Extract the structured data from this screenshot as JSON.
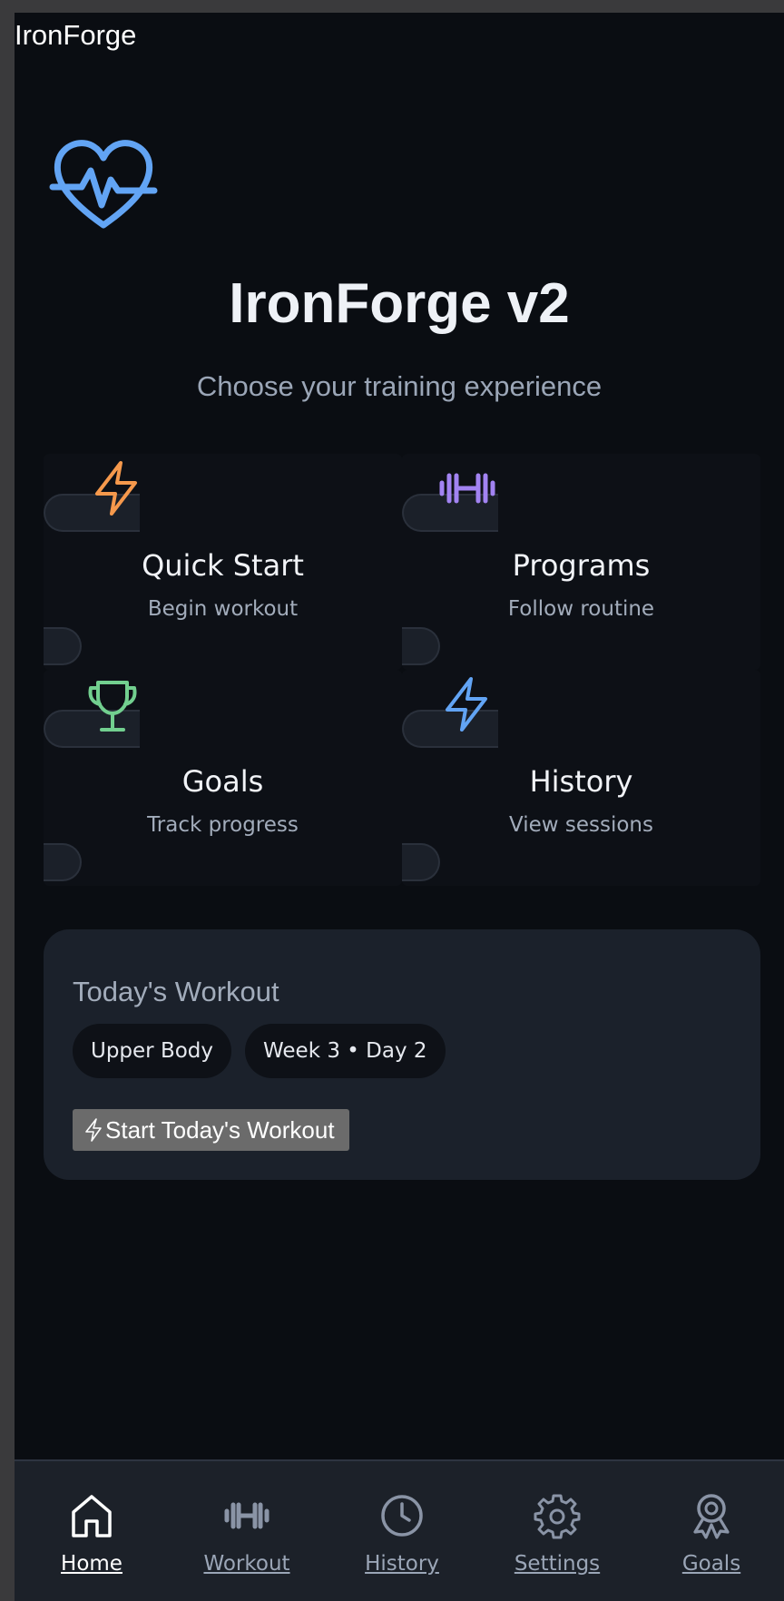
{
  "app": {
    "window_title": "IronForge"
  },
  "hero": {
    "icon": "heart-pulse-icon",
    "title": "IronForge v2",
    "subtitle": "Choose your training experience"
  },
  "cards": [
    {
      "icon": "lightning-icon",
      "title": "Quick Start",
      "subtitle": "Begin workout",
      "icon_color": "#f6994c"
    },
    {
      "icon": "dumbbell-icon",
      "title": "Programs",
      "subtitle": "Follow routine",
      "icon_color": "#a283f2"
    },
    {
      "icon": "trophy-icon",
      "title": "Goals",
      "subtitle": "Track progress",
      "icon_color": "#72cf8f"
    },
    {
      "icon": "lightning-icon",
      "title": "History",
      "subtitle": "View sessions",
      "icon_color": "#62a4f4"
    }
  ],
  "today": {
    "title": "Today's Workout",
    "chips": [
      "Upper Body",
      "Week 3 • Day 2"
    ],
    "start_button": "Start Today's Workout"
  },
  "nav": {
    "items": [
      {
        "label": "Home",
        "icon": "home-icon",
        "active": true
      },
      {
        "label": "Workout",
        "icon": "dumbbell-icon",
        "active": false
      },
      {
        "label": "History",
        "icon": "clock-icon",
        "active": false
      },
      {
        "label": "Settings",
        "icon": "gear-icon",
        "active": false
      },
      {
        "label": "Goals",
        "icon": "award-icon",
        "active": false
      }
    ]
  },
  "colors": {
    "background": "#0a0d12",
    "surface": "#1b212b",
    "accent_blue": "#62a4f4",
    "text_primary": "#eef1f6",
    "text_secondary": "#9ba6b7"
  }
}
